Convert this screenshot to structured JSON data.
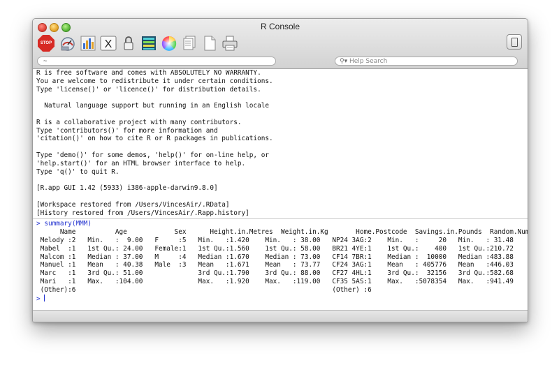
{
  "window": {
    "title": "R Console"
  },
  "toolbar": {
    "items": [
      {
        "name": "stop",
        "label": "STOP"
      },
      {
        "name": "gauge-icon"
      },
      {
        "name": "bar-chart-icon"
      },
      {
        "name": "x11-icon",
        "label": "X"
      },
      {
        "name": "lock-icon"
      },
      {
        "name": "colors-icon"
      },
      {
        "name": "color-wheel-icon"
      },
      {
        "name": "documents-icon"
      },
      {
        "name": "new-document-icon"
      },
      {
        "name": "printer-icon"
      }
    ],
    "drawer": "drawer-toggle-icon"
  },
  "working_dir": "~",
  "search": {
    "placeholder": "Help Search",
    "icon": "search-icon"
  },
  "console": {
    "prompt_symbol": ">",
    "command": "summary(MMM)",
    "startup": [
      "R is free software and comes with ABSOLUTELY NO WARRANTY.",
      "You are welcome to redistribute it under certain conditions.",
      "Type 'license()' or 'licence()' for distribution details.",
      "",
      "  Natural language support but running in an English locale",
      "",
      "R is a collaborative project with many contributors.",
      "Type 'contributors()' for more information and",
      "'citation()' on how to cite R or R packages in publications.",
      "",
      "Type 'demo()' for some demos, 'help()' for on-line help, or",
      "'help.start()' for an HTML browser interface to help.",
      "Type 'q()' to quit R.",
      "",
      "[R.app GUI 1.42 (5933) i386-apple-darwin9.8.0]",
      "",
      "[Workspace restored from /Users/VincesAir/.RData]",
      "[History restored from /Users/VincesAir/.Rapp.history]"
    ],
    "output": [
      "      Name          Age            Sex      Height.in.Metres  Weight.in.Kg       Home.Postcode  Savings.in.Pounds  Random.Number",
      " Melody :2   Min.   :  9.00   F     :5   Min.   :1.420    Min.   : 38.00   NP24 3AG:2    Min.   :     20   Min.   : 31.48",
      " Mabel  :1   1st Qu.: 24.00   Female:1   1st Qu.:1.560    1st Qu.: 58.00   BR21 4YE:1    1st Qu.:    400   1st Qu.:210.72",
      " Malcom :1   Median : 37.00   M     :4   Median :1.670    Median : 73.00   CF14 7BR:1    Median :  10000   Median :483.88",
      " Manuel :1   Mean   : 40.38   Male  :3   Mean   :1.671    Mean   : 73.77   CF24 3AG:1    Mean   : 405776   Mean   :446.03",
      " Marc   :1   3rd Qu.: 51.00              3rd Qu.:1.790    3rd Qu.: 88.00   CF27 4HL:1    3rd Qu.:  32156   3rd Qu.:582.68",
      " Mari   :1   Max.   :104.00              Max.   :1.920    Max.   :119.00   CF35 5AS:1    Max.   :5078354   Max.   :941.49",
      " (Other):6                                                                 (Other) :6"
    ]
  }
}
